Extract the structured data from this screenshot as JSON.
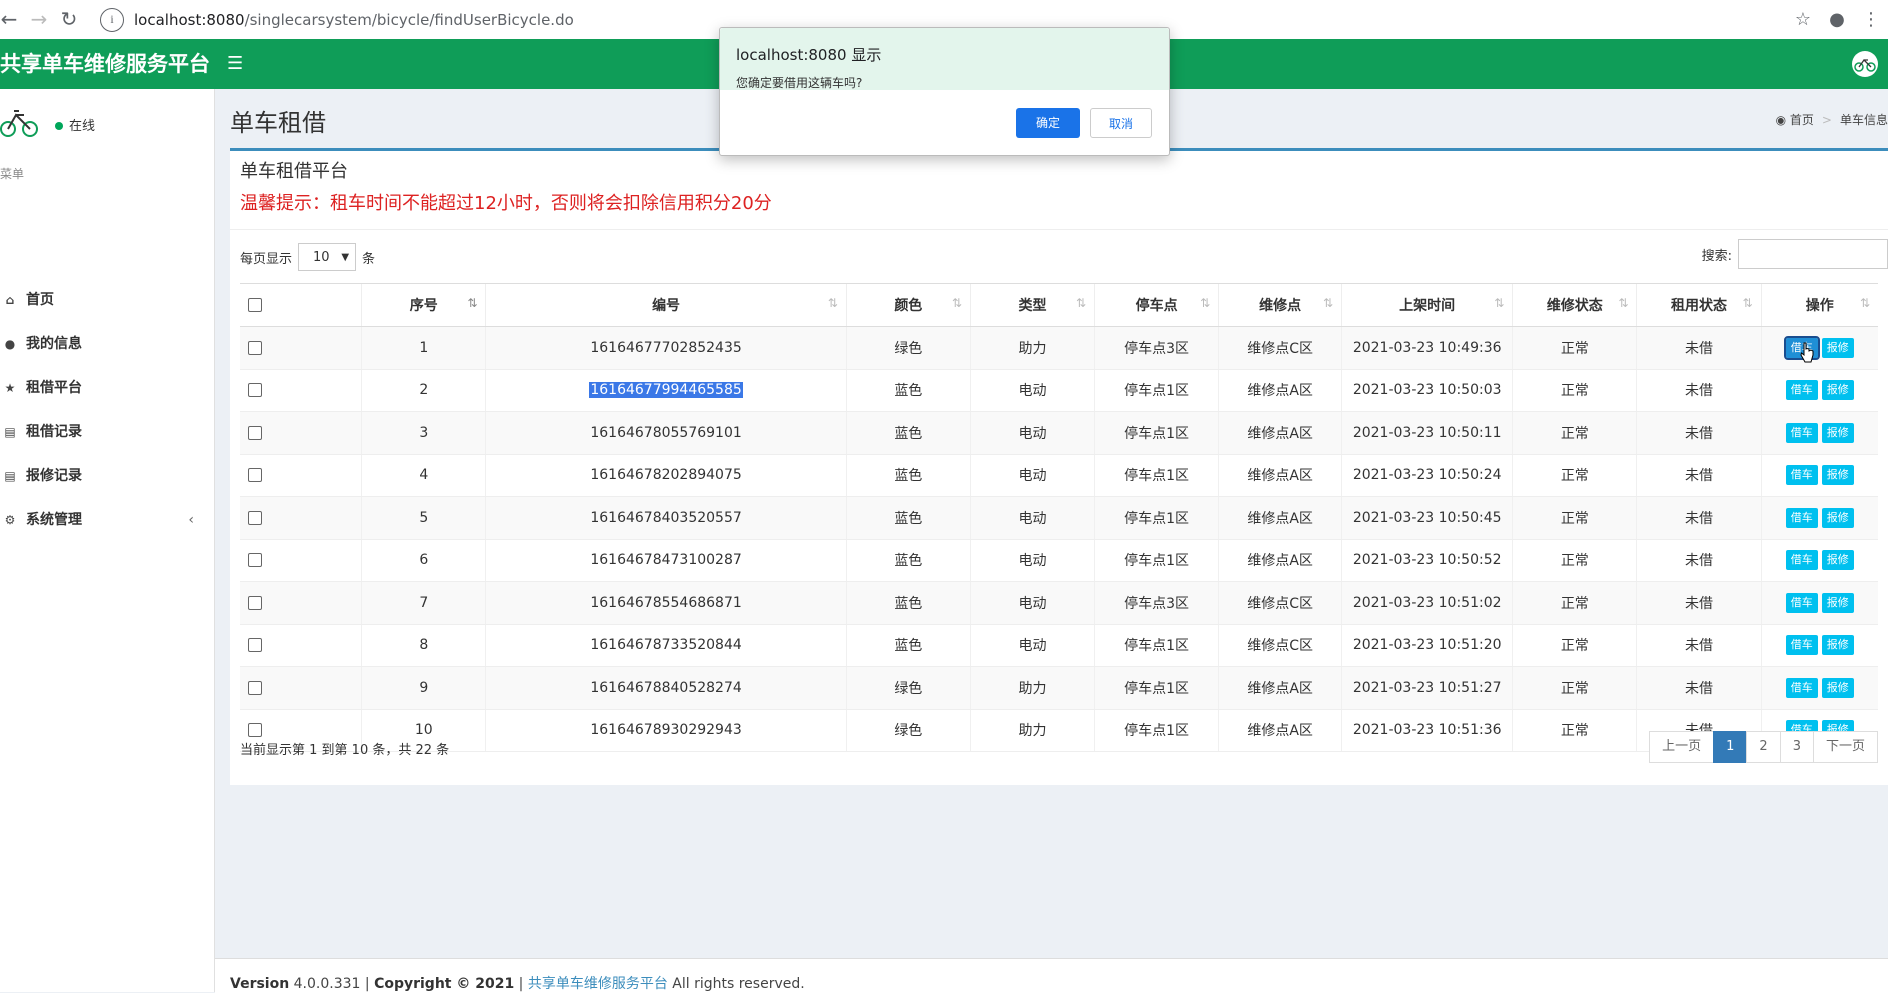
{
  "browser": {
    "url_host": "localhost:8080",
    "url_path": "/singlecarsystem/bicycle/findUserBicycle.do"
  },
  "app": {
    "brand": "共享单车维修服务平台",
    "status": "在线"
  },
  "sidebar": {
    "menu_header": "菜单",
    "items": [
      {
        "label": "首页",
        "icon": "home-icon"
      },
      {
        "label": "我的信息",
        "icon": "user-icon"
      },
      {
        "label": "租借平台",
        "icon": "trophy-icon"
      },
      {
        "label": "租借记录",
        "icon": "bar-chart-icon"
      },
      {
        "label": "报修记录",
        "icon": "bar-chart-icon"
      },
      {
        "label": "系统管理",
        "icon": "gear-icon"
      }
    ]
  },
  "page": {
    "title": "单车租借",
    "breadcrumb_home": "首页",
    "breadcrumb_current": "单车信息"
  },
  "box": {
    "title": "单车租借平台",
    "tip": "温馨提示：租车时间不能超过12小时，否则将会扣除信用积分20分"
  },
  "table_controls": {
    "length_prefix": "每页显示",
    "length_value": "10",
    "length_suffix": "条",
    "search_label": "搜索:"
  },
  "table": {
    "headers": [
      "序号",
      "编号",
      "颜色",
      "类型",
      "停车点",
      "维修点",
      "上架时间",
      "维修状态",
      "租用状态",
      "操作"
    ],
    "rows": [
      {
        "no": "1",
        "code": "16164677702852435",
        "color": "绿色",
        "type": "助力",
        "park": "停车点3区",
        "repair": "维修点C区",
        "time": "2021-03-23 10:49:36",
        "rstatus": "正常",
        "lstatus": "未借"
      },
      {
        "no": "2",
        "code": "16164677994465585",
        "color": "蓝色",
        "type": "电动",
        "park": "停车点1区",
        "repair": "维修点A区",
        "time": "2021-03-23 10:50:03",
        "rstatus": "正常",
        "lstatus": "未借"
      },
      {
        "no": "3",
        "code": "16164678055769101",
        "color": "蓝色",
        "type": "电动",
        "park": "停车点1区",
        "repair": "维修点A区",
        "time": "2021-03-23 10:50:11",
        "rstatus": "正常",
        "lstatus": "未借"
      },
      {
        "no": "4",
        "code": "16164678202894075",
        "color": "蓝色",
        "type": "电动",
        "park": "停车点1区",
        "repair": "维修点A区",
        "time": "2021-03-23 10:50:24",
        "rstatus": "正常",
        "lstatus": "未借"
      },
      {
        "no": "5",
        "code": "16164678403520557",
        "color": "蓝色",
        "type": "电动",
        "park": "停车点1区",
        "repair": "维修点A区",
        "time": "2021-03-23 10:50:45",
        "rstatus": "正常",
        "lstatus": "未借"
      },
      {
        "no": "6",
        "code": "16164678473100287",
        "color": "蓝色",
        "type": "电动",
        "park": "停车点1区",
        "repair": "维修点A区",
        "time": "2021-03-23 10:50:52",
        "rstatus": "正常",
        "lstatus": "未借"
      },
      {
        "no": "7",
        "code": "16164678554686871",
        "color": "蓝色",
        "type": "电动",
        "park": "停车点3区",
        "repair": "维修点C区",
        "time": "2021-03-23 10:51:02",
        "rstatus": "正常",
        "lstatus": "未借"
      },
      {
        "no": "8",
        "code": "16164678733520844",
        "color": "蓝色",
        "type": "电动",
        "park": "停车点1区",
        "repair": "维修点C区",
        "time": "2021-03-23 10:51:20",
        "rstatus": "正常",
        "lstatus": "未借"
      },
      {
        "no": "9",
        "code": "16164678840528274",
        "color": "绿色",
        "type": "助力",
        "park": "停车点1区",
        "repair": "维修点A区",
        "time": "2021-03-23 10:51:27",
        "rstatus": "正常",
        "lstatus": "未借"
      },
      {
        "no": "10",
        "code": "16164678930292943",
        "color": "绿色",
        "type": "助力",
        "park": "停车点1区",
        "repair": "维修点A区",
        "time": "2021-03-23 10:51:36",
        "rstatus": "正常",
        "lstatus": "未借"
      }
    ],
    "borrow_label": "借车",
    "report_label": "报修"
  },
  "pagination": {
    "info": "当前显示第 1 到第 10 条，共 22 条",
    "prev": "上一页",
    "pages": [
      "1",
      "2",
      "3"
    ],
    "next": "下一页",
    "active_page": "1"
  },
  "footer": {
    "version_label": "Version",
    "version": "4.0.0.331",
    "copyright": "Copyright © 2021",
    "link": "共享单车维修服务平台",
    "rights": "All rights reserved."
  },
  "dialog": {
    "title": "localhost:8080 显示",
    "message": "您确定要借用这辆车吗?",
    "ok": "确定",
    "cancel": "取消"
  },
  "colors": {
    "header_green": "#0f9d58",
    "primary_blue": "#3c8dbc",
    "tip_red": "#dd2222",
    "button_cyan": "#00c0ef"
  }
}
